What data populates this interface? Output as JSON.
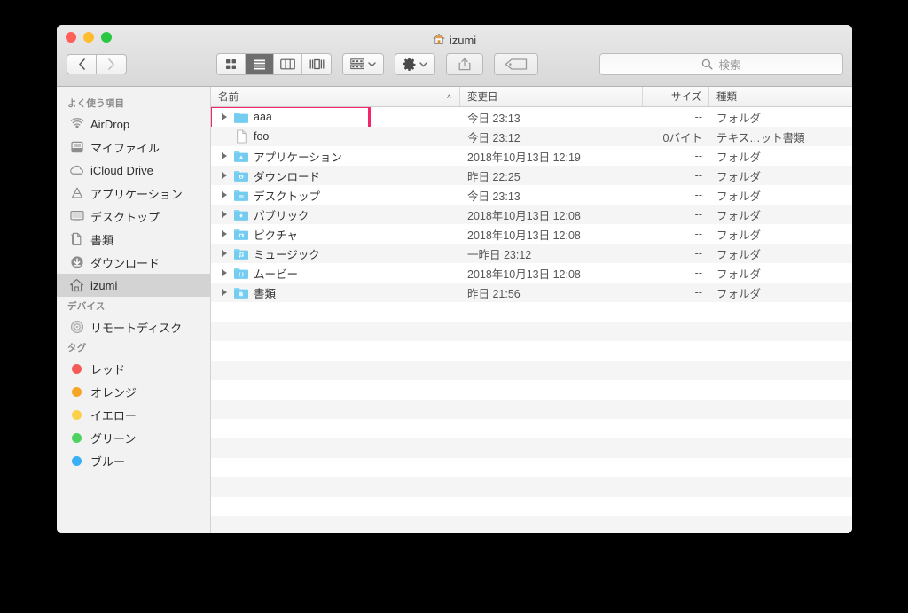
{
  "window": {
    "title": "izumi",
    "title_icon": "home-icon",
    "traffic_lights": [
      "close",
      "minimize",
      "maximize"
    ]
  },
  "toolbar": {
    "back_label": "‹",
    "forward_label": "›",
    "view_buttons": [
      {
        "name": "icon-view",
        "selected": false
      },
      {
        "name": "list-view",
        "selected": true
      },
      {
        "name": "column-view",
        "selected": false
      },
      {
        "name": "coverflow-view",
        "selected": false
      }
    ],
    "arrange_button": "arrange-icon",
    "action_button": "gear-icon",
    "share_button": "share-icon",
    "tag_button": "tag-icon"
  },
  "search": {
    "placeholder": "検索",
    "icon": "search-icon",
    "value": ""
  },
  "sidebar": {
    "sections": [
      {
        "header": "よく使う項目",
        "items": [
          {
            "label": "AirDrop",
            "icon": "airdrop-icon",
            "selected": false
          },
          {
            "label": "マイファイル",
            "icon": "allmyfiles-icon",
            "selected": false
          },
          {
            "label": "iCloud Drive",
            "icon": "icloud-icon",
            "selected": false
          },
          {
            "label": "アプリケーション",
            "icon": "applications-icon",
            "selected": false
          },
          {
            "label": "デスクトップ",
            "icon": "desktop-icon",
            "selected": false
          },
          {
            "label": "書類",
            "icon": "documents-icon",
            "selected": false
          },
          {
            "label": "ダウンロード",
            "icon": "downloads-icon",
            "selected": false
          },
          {
            "label": "izumi",
            "icon": "home-icon",
            "selected": true
          }
        ]
      },
      {
        "header": "デバイス",
        "items": [
          {
            "label": "リモートディスク",
            "icon": "remotedisc-icon",
            "selected": false
          }
        ]
      },
      {
        "header": "タグ",
        "items": [
          {
            "label": "レッド",
            "icon": "tag-dot",
            "color": "#f35b57",
            "selected": false
          },
          {
            "label": "オレンジ",
            "icon": "tag-dot",
            "color": "#f5a623",
            "selected": false
          },
          {
            "label": "イエロー",
            "icon": "tag-dot",
            "color": "#fbd14b",
            "selected": false
          },
          {
            "label": "グリーン",
            "icon": "tag-dot",
            "color": "#4cd35f",
            "selected": false
          },
          {
            "label": "ブルー",
            "icon": "tag-dot",
            "color": "#39aff5",
            "selected": false
          }
        ]
      }
    ]
  },
  "file_list": {
    "columns": [
      {
        "key": "name",
        "label": "名前",
        "sorted": true,
        "sort_arrow": "˄"
      },
      {
        "key": "date",
        "label": "変更日",
        "sorted": false
      },
      {
        "key": "size",
        "label": "サイズ",
        "sorted": false
      },
      {
        "key": "kind",
        "label": "種類",
        "sorted": false
      }
    ],
    "highlight_row_index": 0,
    "highlight_color": "#f4256b",
    "rows": [
      {
        "name": "aaa",
        "date": "今日 23:13",
        "size": "--",
        "kind": "フォルダ",
        "icon": "folder-icon",
        "expandable": true
      },
      {
        "name": "foo",
        "date": "今日 23:12",
        "size": "0バイト",
        "kind": "テキス…ット書類",
        "icon": "document-icon",
        "expandable": false
      },
      {
        "name": "アプリケーション",
        "date": "2018年10月13日 12:19",
        "size": "--",
        "kind": "フォルダ",
        "icon": "folder-applications-icon",
        "expandable": true
      },
      {
        "name": "ダウンロード",
        "date": "昨日 22:25",
        "size": "--",
        "kind": "フォルダ",
        "icon": "folder-downloads-icon",
        "expandable": true
      },
      {
        "name": "デスクトップ",
        "date": "今日 23:13",
        "size": "--",
        "kind": "フォルダ",
        "icon": "folder-desktop-icon",
        "expandable": true
      },
      {
        "name": "パブリック",
        "date": "2018年10月13日 12:08",
        "size": "--",
        "kind": "フォルダ",
        "icon": "folder-public-icon",
        "expandable": true
      },
      {
        "name": "ピクチャ",
        "date": "2018年10月13日 12:08",
        "size": "--",
        "kind": "フォルダ",
        "icon": "folder-pictures-icon",
        "expandable": true
      },
      {
        "name": "ミュージック",
        "date": "一昨日 23:12",
        "size": "--",
        "kind": "フォルダ",
        "icon": "folder-music-icon",
        "expandable": true
      },
      {
        "name": "ムービー",
        "date": "2018年10月13日 12:08",
        "size": "--",
        "kind": "フォルダ",
        "icon": "folder-movies-icon",
        "expandable": true
      },
      {
        "name": "書類",
        "date": "昨日 21:56",
        "size": "--",
        "kind": "フォルダ",
        "icon": "folder-documents-icon",
        "expandable": true
      }
    ],
    "empty_row_count": 12
  }
}
